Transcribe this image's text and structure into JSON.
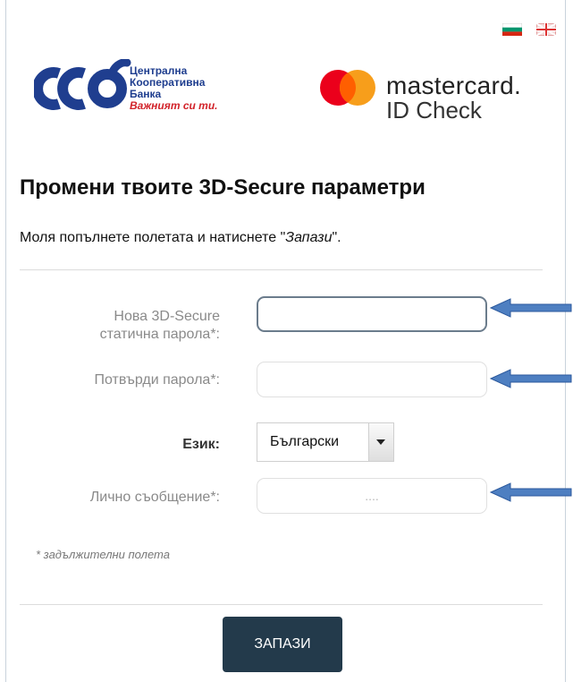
{
  "languages": {
    "bg_flag": "bulgarian-flag-icon",
    "en_flag": "uk-flag-icon"
  },
  "bank_logo": {
    "line1": "Централна",
    "line2": "Кооперативна",
    "line3": "Банка",
    "slogan": "Важният си ти.",
    "colors": {
      "blue": "#1f3e8f",
      "red": "#d2232a"
    }
  },
  "mastercard_logo": {
    "brand": "mastercard.",
    "product": "ID Check",
    "colors": {
      "red": "#eb001b",
      "yellow": "#f79e1b",
      "orange": "#ff5f00"
    }
  },
  "page": {
    "title": "Промени твоите 3D-Secure параметри",
    "instruction_prefix": "Моля попълнете полетата и натиснете \"",
    "instruction_action": "Запази",
    "instruction_suffix": "\"."
  },
  "form": {
    "password_label_line1": "Нова 3D-Secure",
    "password_label_line2": "статична парола*:",
    "password_value": "",
    "confirm_label": "Потвърди парола*:",
    "confirm_value": "",
    "language_label": "Език:",
    "language_selected": "Български",
    "message_label": "Лично съобщение*:",
    "message_placeholder": "....",
    "required_note": "* задължителни полета",
    "save_label": "ЗАПАЗИ"
  },
  "colors": {
    "button_bg": "#233a4b",
    "arrow_fill": "#4e7fc1"
  }
}
